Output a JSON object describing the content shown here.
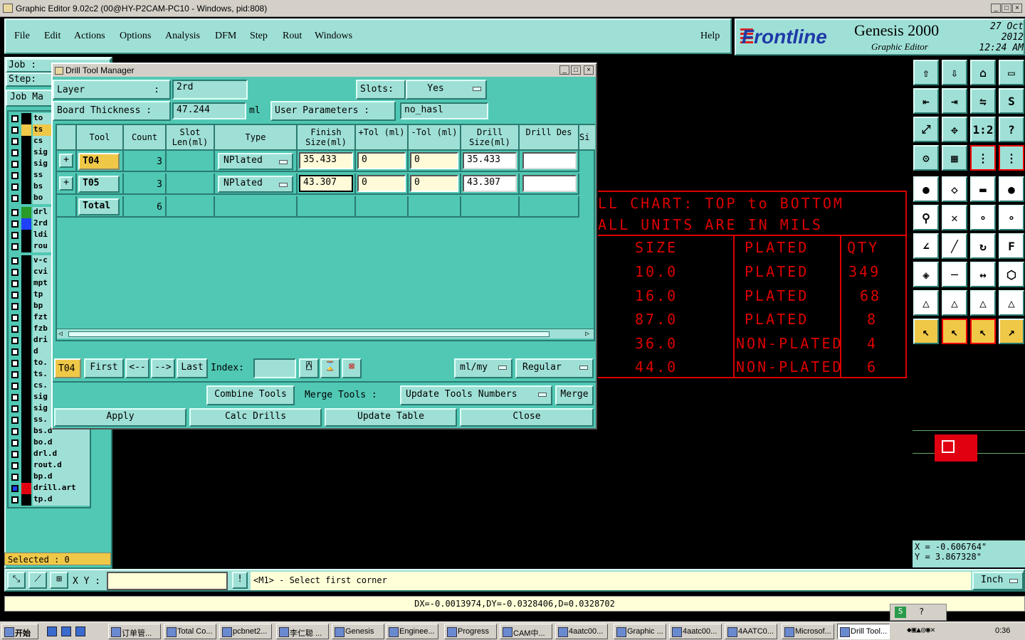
{
  "window": {
    "title": "Graphic Editor 9.02c2 (00@HY-P2CAM-PC10 - Windows, pid:808)"
  },
  "menu": {
    "items": [
      "File",
      "Edit",
      "Actions",
      "Options",
      "Analysis",
      "DFM",
      "Step",
      "Rout",
      "Windows"
    ],
    "help": "Help"
  },
  "brand": {
    "logo": "Frontline",
    "product": "Genesis 2000",
    "sub": "Graphic Editor",
    "date": "27 Oct 2012",
    "time": "12:24 AM"
  },
  "left": {
    "job_label": "Job :",
    "step_label": "Step:",
    "job_manager": "Job Ma",
    "selected": "Selected : 0",
    "layers": [
      "to",
      "ts",
      "cs",
      "sig",
      "sig",
      "ss",
      "bs",
      "bo",
      "drl",
      "2rd",
      "ldi",
      "rou",
      "v-c",
      "cvi",
      "mpt",
      "tp",
      "bp",
      "fzt",
      "fzb",
      "dri",
      "d",
      "to.",
      "ts.",
      "cs.",
      "sig",
      "sig",
      "ss.",
      "bs.d",
      "bo.d",
      "drl.d",
      "rout.d",
      "bp.d",
      "drill.art",
      "tp.d"
    ]
  },
  "dialog": {
    "title": "Drill Tool Manager",
    "layer_label": "Layer",
    "layer_colon": ":",
    "layer_value": "2rd",
    "slots_label": "Slots:",
    "slots_value": "Yes",
    "board_label": "Board Thickness :",
    "board_value": "47.244",
    "board_unit": "ml",
    "user_params_label": "User Parameters :",
    "user_params_value": "no_hasl",
    "columns": [
      "Tool",
      "Count",
      "Slot Len(ml)",
      "Type",
      "Finish Size(ml)",
      "+Tol (ml)",
      "-Tol (ml)",
      "Drill Size(ml)",
      "Drill Des",
      "Si"
    ],
    "rows": [
      {
        "tool": "T04",
        "count": "3",
        "type": "NPlated",
        "finish": "35.433",
        "ptol": "0",
        "mtol": "0",
        "drill": "35.433",
        "des": ""
      },
      {
        "tool": "T05",
        "count": "3",
        "type": "NPlated",
        "finish": "43.307",
        "ptol": "0",
        "mtol": "0",
        "drill": "43.307",
        "des": ""
      }
    ],
    "total_label": "Total",
    "total_count": "6",
    "nav": {
      "current": "T04",
      "first": "First",
      "prev": "<--",
      "next": "-->",
      "last": "Last",
      "index_label": "Index:",
      "units": "ml/my",
      "mode": "Regular"
    },
    "combine": "Combine Tools",
    "merge_label": "Merge Tools :",
    "update_numbers": "Update Tools Numbers",
    "merge": "Merge",
    "apply": "Apply",
    "calc": "Calc Drills",
    "update_table": "Update Table",
    "close": "Close"
  },
  "chart": {
    "line1": "LL CHART: TOP to BOTTOM",
    "line2": "ALL UNITS ARE IN MILS",
    "headers": [
      "SIZE",
      "PLATED",
      "QTY"
    ],
    "rows": [
      [
        "10.0",
        "PLATED",
        "349"
      ],
      [
        "16.0",
        "PLATED",
        "68"
      ],
      [
        "87.0",
        "PLATED",
        "8"
      ],
      [
        "36.0",
        "NON-PLATED",
        "4"
      ],
      [
        "44.0",
        "NON-PLATED",
        "6"
      ]
    ]
  },
  "coords": {
    "x": "X = -0.606764\"",
    "y": "Y = 3.867328\""
  },
  "status": {
    "xy_label": "X Y :",
    "prompt": "<M1> - Select first corner",
    "units": "Inch"
  },
  "message": "DX=-0.0013974,DY=-0.0328406,D=0.0328702",
  "taskbar": {
    "start": "开始",
    "items": [
      "订单管...",
      "Total Co...",
      "pcbnet2...",
      "李仁聪 ...",
      "Genesis",
      "Enginee...",
      "Progress",
      "CAM中...",
      "4aatc00...",
      "Graphic ...",
      "4aatc00...",
      "4AATC0...",
      "Microsof...",
      "Drill Tool..."
    ],
    "clock": "0:36"
  },
  "colors": {
    "panel": "#50c8b4",
    "light": "#9fe0d6",
    "accent": "#f0c848",
    "chart_red": "#dd0000"
  }
}
